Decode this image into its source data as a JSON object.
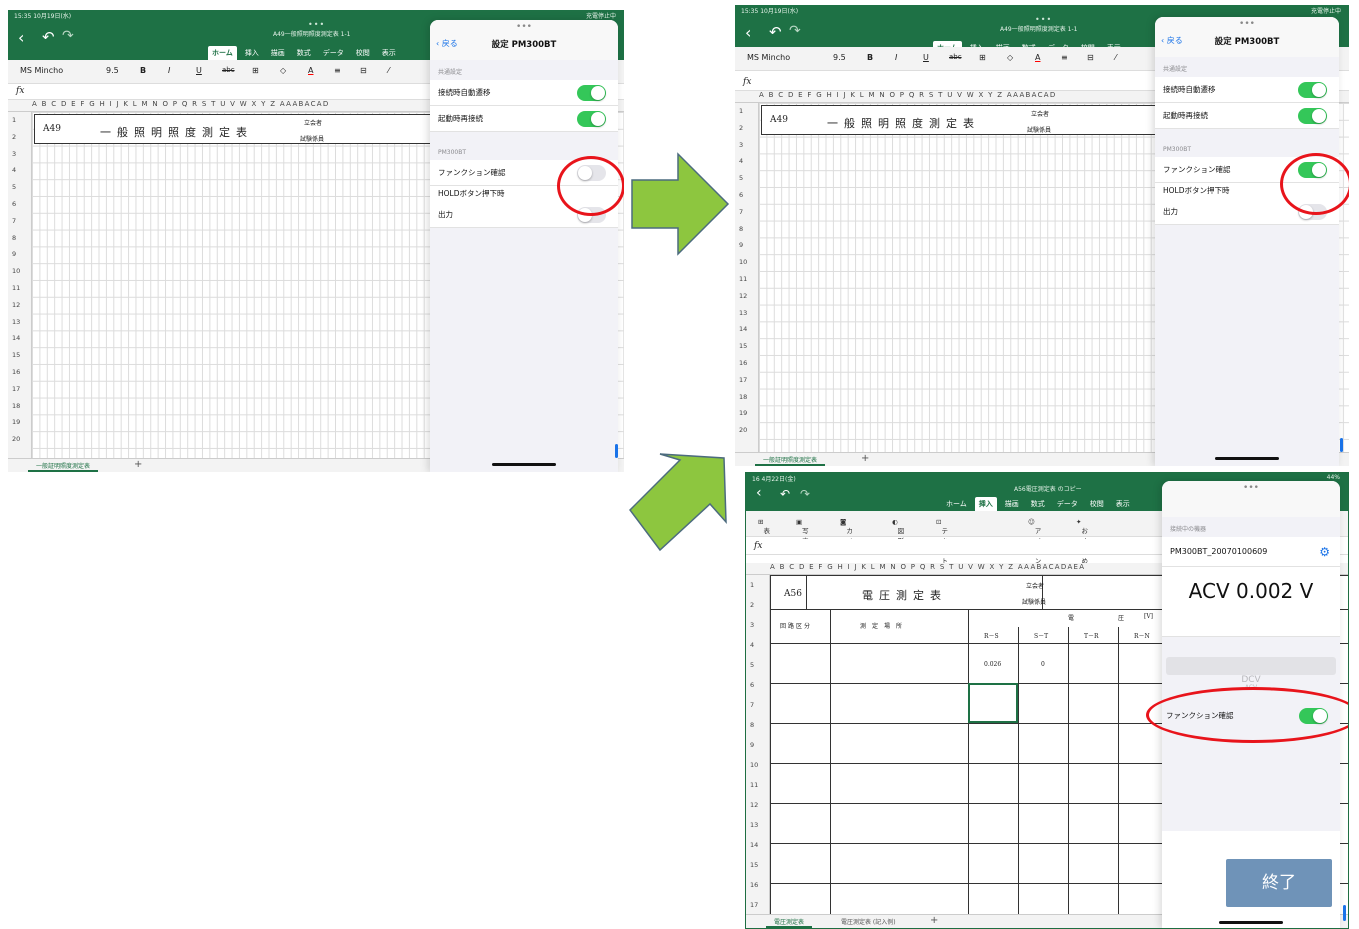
{
  "shot1": {
    "status_left": "15:35  10月19日(水)",
    "status_right": "充電停止中",
    "doc_title": "A49一般照明照度測定表 1-1",
    "tabs": [
      "ホーム",
      "挿入",
      "描画",
      "数式",
      "データ",
      "校閲",
      "表示"
    ],
    "active_tab": "ホーム",
    "font_name": "MS Mincho",
    "font_size": "9.5",
    "fx": "fx",
    "columns": "A B C D E F G H I J K L M N O P Q R S T U V   W   X Y Z AAABACAD",
    "cell_ref": "A49",
    "sheet_title": "一般照明照度測定表",
    "label_tachiai": "立会者",
    "label_shiken": "試験係員",
    "rows": [
      "1",
      "2",
      "3",
      "4",
      "5",
      "6",
      "7",
      "8",
      "9",
      "10",
      "11",
      "12",
      "13",
      "14",
      "15",
      "16",
      "17",
      "18",
      "19",
      "20"
    ],
    "sheet_tab": "一般証明照度測定表",
    "add_sheet": "+",
    "panel": {
      "back": "戻る",
      "title": "設定 PM300BT",
      "section1": "共通設定",
      "items1": [
        {
          "label": "接続時自動遷移",
          "on": true
        },
        {
          "label": "起動時再接続",
          "on": true
        }
      ],
      "section2": "PM300BT",
      "function_label": "ファンクション確認",
      "function_on": false,
      "hold_label": "HOLDボタン押下時",
      "output_label": "出力",
      "output_on": false
    }
  },
  "shot2": {
    "status_left": "15:35  10月19日(水)",
    "status_right": "充電停止中",
    "doc_title": "A49一般照明照度測定表 1-1",
    "tabs": [
      "ホーム",
      "挿入",
      "描画",
      "数式",
      "データ",
      "校閲",
      "表示"
    ],
    "active_tab": "ホーム",
    "font_name": "MS Mincho",
    "font_size": "9.5",
    "fx": "fx",
    "columns": "A B C D E F G H I J K L M N O P Q R S T U V   W   X Y Z AAABACAD",
    "cell_ref": "A49",
    "sheet_title": "一般照明照度測定表",
    "label_tachiai": "立会者",
    "label_shiken": "試験係員",
    "rows": [
      "1",
      "2",
      "3",
      "4",
      "5",
      "6",
      "7",
      "8",
      "9",
      "10",
      "11",
      "12",
      "13",
      "14",
      "15",
      "16",
      "17",
      "18",
      "19",
      "20"
    ],
    "sheet_tab": "一般証明照度測定表",
    "add_sheet": "+",
    "panel": {
      "back": "戻る",
      "title": "設定 PM300BT",
      "section1": "共通設定",
      "items1": [
        {
          "label": "接続時自動遷移",
          "on": true
        },
        {
          "label": "起動時再接続",
          "on": true
        }
      ],
      "section2": "PM300BT",
      "function_label": "ファンクション確認",
      "function_on": true,
      "hold_label": "HOLDボタン押下時",
      "output_label": "出力",
      "output_on": false
    }
  },
  "shot3": {
    "status_left": "16  4月22日(金)",
    "status_right": "44%",
    "doc_title": "A56電圧測定表 のコピー",
    "tabs": [
      "ホーム",
      "挿入",
      "描画",
      "数式",
      "データ",
      "校閲",
      "表示"
    ],
    "active_tab": "挿入",
    "insert_items": [
      "表",
      "写真",
      "カメラ",
      "図形",
      "テキストボックス",
      "アイコン",
      "おすすめ"
    ],
    "fx": "fx",
    "columns": "A B C D E F G H I J K L M N O P Q R S T U V W X Y Z AAABACADAEA",
    "cell_ref": "A56",
    "sheet_title": "電圧測定表",
    "label_tachiai": "立会者",
    "label_shiken": "試験係員",
    "hdr_denatsu": "電",
    "hdr_atsu": "圧",
    "hdr_unit": "[V]",
    "hdr_kubun": "回路区分",
    "hdr_sokutei": "測　定　場　所",
    "hdr_rs": "R－S",
    "hdr_st": "S－T",
    "hdr_tr": "T－R",
    "hdr_rn": "R－N",
    "val_rs": "0.026",
    "val_st": "0",
    "rows": [
      "1",
      "2",
      "3",
      "4",
      "5",
      "6",
      "7",
      "8",
      "9",
      "10",
      "11",
      "12",
      "13",
      "14",
      "15",
      "16",
      "17"
    ],
    "sheet_tabs": [
      "電圧測定表",
      "電圧測定表 (記入例)"
    ],
    "add_sheet": "+",
    "panel": {
      "section": "接続中の機器",
      "device": "PM300BT_20070100609",
      "reading": "ACV 0.002 V",
      "mode_lines": [
        "DCV",
        "ACV"
      ],
      "function_label": "ファンクション確認",
      "function_on": true,
      "end_button": "終了"
    }
  },
  "colors": {
    "excel_green": "#1e7145",
    "toggle_on": "#34c759",
    "highlight_red": "#e8141b",
    "arrow_green": "#8dc63f",
    "end_button": "#6f93b8"
  }
}
